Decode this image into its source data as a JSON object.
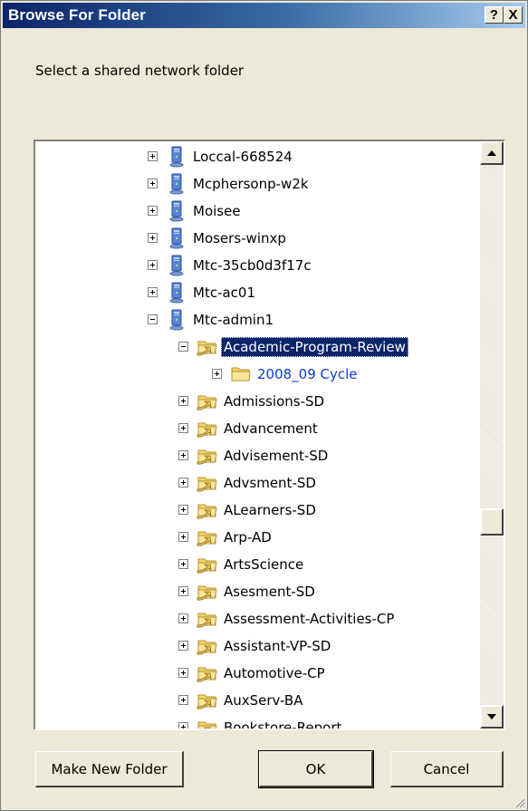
{
  "window": {
    "title": "Browse For Folder"
  },
  "titlebar_buttons": {
    "help": "?",
    "close": "X"
  },
  "instruction": "Select a shared network folder",
  "tree": {
    "items": [
      {
        "label": "Loccal-668524",
        "icon": "computer-icon",
        "level": 0,
        "expander": "plus"
      },
      {
        "label": "Mcphersonp-w2k",
        "icon": "computer-icon",
        "level": 0,
        "expander": "plus"
      },
      {
        "label": "Moisee",
        "icon": "computer-icon",
        "level": 0,
        "expander": "plus"
      },
      {
        "label": "Mosers-winxp",
        "icon": "computer-icon",
        "level": 0,
        "expander": "plus"
      },
      {
        "label": "Mtc-35cb0d3f17c",
        "icon": "computer-icon",
        "level": 0,
        "expander": "plus"
      },
      {
        "label": "Mtc-ac01",
        "icon": "computer-icon",
        "level": 0,
        "expander": "plus"
      },
      {
        "label": "Mtc-admin1",
        "icon": "computer-icon",
        "level": 0,
        "expander": "minus"
      },
      {
        "label": "Academic-Program-Review",
        "icon": "shared-folder-icon",
        "level": 1,
        "expander": "minus",
        "selected": true
      },
      {
        "label": "2008_09 Cycle",
        "icon": "folder-icon",
        "level": 2,
        "expander": "plus",
        "blue": true
      },
      {
        "label": "Admissions-SD",
        "icon": "shared-folder-icon",
        "level": 1,
        "expander": "plus"
      },
      {
        "label": "Advancement",
        "icon": "shared-folder-icon",
        "level": 1,
        "expander": "plus"
      },
      {
        "label": "Advisement-SD",
        "icon": "shared-folder-icon",
        "level": 1,
        "expander": "plus"
      },
      {
        "label": "Advsment-SD",
        "icon": "shared-folder-icon",
        "level": 1,
        "expander": "plus"
      },
      {
        "label": "ALearners-SD",
        "icon": "shared-folder-icon",
        "level": 1,
        "expander": "plus"
      },
      {
        "label": "Arp-AD",
        "icon": "shared-folder-icon",
        "level": 1,
        "expander": "plus"
      },
      {
        "label": "ArtsScience",
        "icon": "shared-folder-icon",
        "level": 1,
        "expander": "plus"
      },
      {
        "label": "Asesment-SD",
        "icon": "shared-folder-icon",
        "level": 1,
        "expander": "plus"
      },
      {
        "label": "Assessment-Activities-CP",
        "icon": "shared-folder-icon",
        "level": 1,
        "expander": "plus"
      },
      {
        "label": "Assistant-VP-SD",
        "icon": "shared-folder-icon",
        "level": 1,
        "expander": "plus"
      },
      {
        "label": "Automotive-CP",
        "icon": "shared-folder-icon",
        "level": 1,
        "expander": "plus"
      },
      {
        "label": "AuxServ-BA",
        "icon": "shared-folder-icon",
        "level": 1,
        "expander": "plus"
      },
      {
        "label": "Bookstore-Report",
        "icon": "shared-folder-icon",
        "level": 1,
        "expander": "plus"
      }
    ]
  },
  "buttons": {
    "make_new_folder": "Make New Folder",
    "ok": "OK",
    "cancel": "Cancel"
  },
  "colors": {
    "titlebar_start": "#0a246a",
    "titlebar_end": "#a6caf0",
    "selection": "#0a246a",
    "link_blue": "#0b3bd6",
    "dialog_bg": "#ece9d8"
  }
}
